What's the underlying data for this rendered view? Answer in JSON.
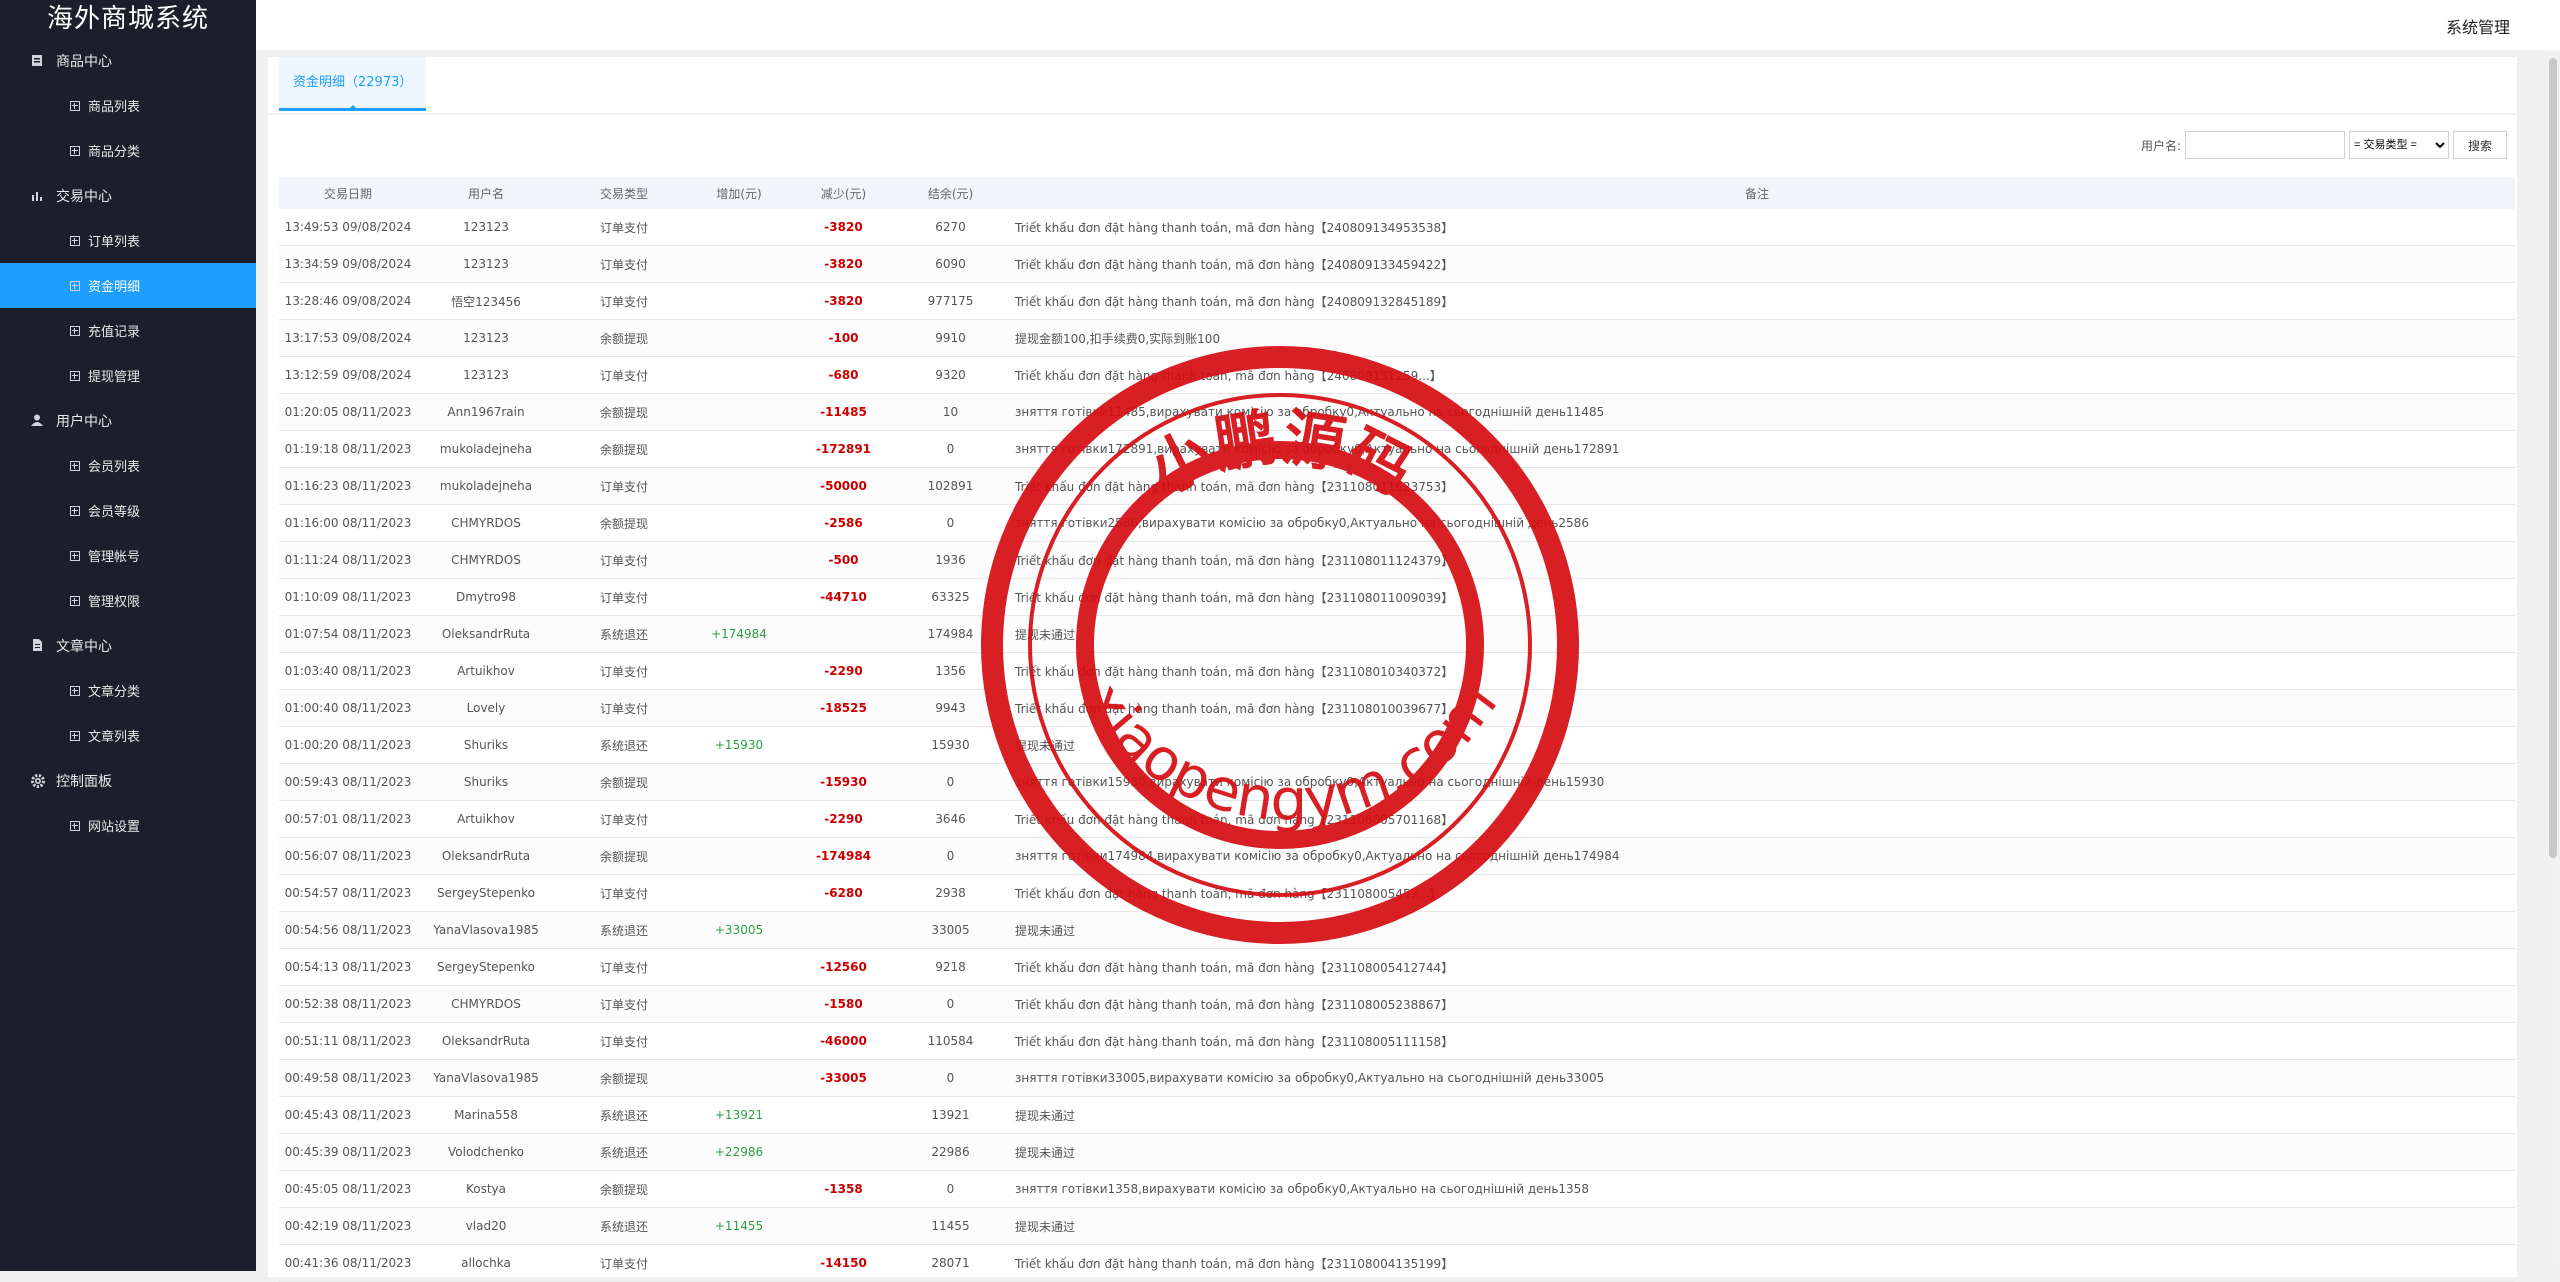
{
  "app": {
    "brand": "海外商城系统",
    "header_title": "系统管理"
  },
  "sidebar": {
    "groups": [
      {
        "label": "商品中心",
        "icon": "clipboard-icon",
        "items": [
          "商品列表",
          "商品分类"
        ]
      },
      {
        "label": "交易中心",
        "icon": "bar-chart-icon",
        "items": [
          "订单列表",
          "资金明细",
          "充值记录",
          "提现管理"
        ]
      },
      {
        "label": "用户中心",
        "icon": "user-icon",
        "items": [
          "会员列表",
          "会员等级",
          "管理帐号",
          "管理权限"
        ]
      },
      {
        "label": "文章中心",
        "icon": "document-icon",
        "items": [
          "文章分类",
          "文章列表"
        ]
      },
      {
        "label": "控制面板",
        "icon": "gear-icon",
        "items": [
          "网站设置"
        ]
      }
    ],
    "active_item": "资金明细"
  },
  "tab": {
    "label": "资金明细（22973）"
  },
  "search": {
    "username_label": "用户名:",
    "username_value": "",
    "type_select": "= 交易类型 =",
    "button": "搜索"
  },
  "table": {
    "columns": [
      "交易日期",
      "用户名",
      "交易类型",
      "增加(元)",
      "减少(元)",
      "结余(元)",
      "备注"
    ],
    "rows": [
      [
        "13:49:53 09/08/2024",
        "123123",
        "订单支付",
        "",
        "-3820",
        "6270",
        "Triết khấu đơn đặt hàng thanh toán, mã đơn hàng【240809134953538】"
      ],
      [
        "13:34:59 09/08/2024",
        "123123",
        "订单支付",
        "",
        "-3820",
        "6090",
        "Triết khấu đơn đặt hàng thanh toán, mã đơn hàng【240809133459422】"
      ],
      [
        "13:28:46 09/08/2024",
        "悟空123456",
        "订单支付",
        "",
        "-3820",
        "977175",
        "Triết khấu đơn đặt hàng thanh toán, mã đơn hàng【240809132845189】"
      ],
      [
        "13:17:53 09/08/2024",
        "123123",
        "余额提现",
        "",
        "-100",
        "9910",
        "提现金额100,扣手续费0,实际到账100"
      ],
      [
        "13:12:59 09/08/2024",
        "123123",
        "订单支付",
        "",
        "-680",
        "9320",
        "Triết khấu đơn đặt hàng thanh toán, mã đơn hàng【240809131259...】"
      ],
      [
        "01:20:05 08/11/2023",
        "Ann1967rain",
        "余额提现",
        "",
        "-11485",
        "10",
        "зняття готівки11485,вирахувати комісію за обробку0,Актуально на сьогоднішній день11485"
      ],
      [
        "01:19:18 08/11/2023",
        "mukoladejneha",
        "余额提现",
        "",
        "-172891",
        "0",
        "зняття готівки172891,вирахувати комісію за обробку0,Актуально на сьогоднішній день172891"
      ],
      [
        "01:16:23 08/11/2023",
        "mukoladejneha",
        "订单支付",
        "",
        "-50000",
        "102891",
        "Triết khấu đơn đặt hàng thanh toán, mã đơn hàng【231108011623753】"
      ],
      [
        "01:16:00 08/11/2023",
        "CHMYRDOS",
        "余额提现",
        "",
        "-2586",
        "0",
        "зняття готівки2586,вирахувати комісію за обробку0,Актуально на сьогоднішній день2586"
      ],
      [
        "01:11:24 08/11/2023",
        "CHMYRDOS",
        "订单支付",
        "",
        "-500",
        "1936",
        "Triết khấu đơn đặt hàng thanh toán, mã đơn hàng【231108011124379】"
      ],
      [
        "01:10:09 08/11/2023",
        "Dmytro98",
        "订单支付",
        "",
        "-44710",
        "63325",
        "Triết khấu đơn đặt hàng thanh toán, mã đơn hàng【231108011009039】"
      ],
      [
        "01:07:54 08/11/2023",
        "OleksandrRuta",
        "系统退还",
        "+174984",
        "",
        "174984",
        "提现未通过"
      ],
      [
        "01:03:40 08/11/2023",
        "Artuikhov",
        "订单支付",
        "",
        "-2290",
        "1356",
        "Triết khấu đơn đặt hàng thanh toán, mã đơn hàng【231108010340372】"
      ],
      [
        "01:00:40 08/11/2023",
        "Lovely",
        "订单支付",
        "",
        "-18525",
        "9943",
        "Triết khấu đơn đặt hàng thanh toán, mã đơn hàng【231108010039677】"
      ],
      [
        "01:00:20 08/11/2023",
        "Shuriks",
        "系统退还",
        "+15930",
        "",
        "15930",
        "提现未通过"
      ],
      [
        "00:59:43 08/11/2023",
        "Shuriks",
        "余额提现",
        "",
        "-15930",
        "0",
        "зняття готівки15930,вирахувати комісію за обробку0,Актуально на сьогоднішній день15930"
      ],
      [
        "00:57:01 08/11/2023",
        "Artuikhov",
        "订单支付",
        "",
        "-2290",
        "3646",
        "Triết khấu đơn đặt hàng thanh toán, mã đơn hàng【231108005701168】"
      ],
      [
        "00:56:07 08/11/2023",
        "OleksandrRuta",
        "余额提现",
        "",
        "-174984",
        "0",
        "зняття готівки174984,вирахувати комісію за обробку0,Актуально на сьогоднішній день174984"
      ],
      [
        "00:54:57 08/11/2023",
        "SergeyStepenko",
        "订单支付",
        "",
        "-6280",
        "2938",
        "Triết khấu đơn đặt hàng thanh toán, mã đơn hàng【231108005457...】"
      ],
      [
        "00:54:56 08/11/2023",
        "YanaVlasova1985",
        "系统退还",
        "+33005",
        "",
        "33005",
        "提现未通过"
      ],
      [
        "00:54:13 08/11/2023",
        "SergeyStepenko",
        "订单支付",
        "",
        "-12560",
        "9218",
        "Triết khấu đơn đặt hàng thanh toán, mã đơn hàng【231108005412744】"
      ],
      [
        "00:52:38 08/11/2023",
        "CHMYRDOS",
        "订单支付",
        "",
        "-1580",
        "0",
        "Triết khấu đơn đặt hàng thanh toán, mã đơn hàng【231108005238867】"
      ],
      [
        "00:51:11 08/11/2023",
        "OleksandrRuta",
        "订单支付",
        "",
        "-46000",
        "110584",
        "Triết khấu đơn đặt hàng thanh toán, mã đơn hàng【231108005111158】"
      ],
      [
        "00:49:58 08/11/2023",
        "YanaVlasova1985",
        "余额提现",
        "",
        "-33005",
        "0",
        "зняття готівки33005,вирахувати комісію за обробку0,Актуально на сьогоднішній день33005"
      ],
      [
        "00:45:43 08/11/2023",
        "Marina558",
        "系统退还",
        "+13921",
        "",
        "13921",
        "提现未通过"
      ],
      [
        "00:45:39 08/11/2023",
        "Volodchenko",
        "系统退还",
        "+22986",
        "",
        "22986",
        "提现未通过"
      ],
      [
        "00:45:05 08/11/2023",
        "Kostya",
        "余额提现",
        "",
        "-1358",
        "0",
        "зняття готівки1358,вирахувати комісію за обробку0,Актуально на сьогоднішній день1358"
      ],
      [
        "00:42:19 08/11/2023",
        "vlad20",
        "系统退还",
        "+11455",
        "",
        "11455",
        "提现未通过"
      ],
      [
        "00:41:36 08/11/2023",
        "allochka",
        "订单支付",
        "",
        "-14150",
        "28071",
        "Triết khấu đơn đặt hàng thanh toán, mã đơn hàng【231108004135199】"
      ]
    ]
  },
  "watermark": {
    "top_text": "小鹏源码",
    "bottom_text": "xiaopengym.com",
    "color": "#d40d12"
  },
  "colors": {
    "sidebar_bg": "#1c1f2b",
    "active": "#1e9fff",
    "decrease": "#cc0000",
    "increase": "#2ea043"
  }
}
